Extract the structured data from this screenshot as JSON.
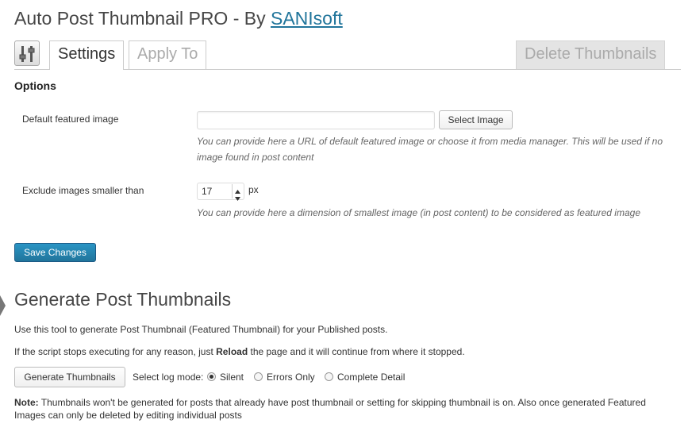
{
  "header": {
    "title_prefix": "Auto Post Thumbnail PRO - By ",
    "title_link": "SANIsoft"
  },
  "tabs": [
    {
      "label": "Settings",
      "active": true
    },
    {
      "label": "Apply To",
      "active": false
    },
    {
      "label": "Delete Thumbnails",
      "active": false
    }
  ],
  "options": {
    "heading": "Options",
    "default_image": {
      "label": "Default featured image",
      "value": "",
      "button": "Select Image",
      "description": "You can provide here a URL of default featured image or choose it from media manager. This will be used if no image found in post content"
    },
    "exclude": {
      "label": "Exclude images smaller than",
      "value": "17",
      "unit": "px",
      "description": "You can provide here a dimension of smallest image (in post content) to be considered as featured image"
    },
    "save_label": "Save Changes"
  },
  "generate": {
    "heading": "Generate Post Thumbnails",
    "intro": "Use this tool to generate Post Thumbnail (Featured Thumbnail) for your Published posts.",
    "reload_pre": "If the script stops executing for any reason, just ",
    "reload_bold": "Reload",
    "reload_post": " the page and it will continue from where it stopped.",
    "button": "Generate Thumbnails",
    "log_mode_label": "Select log mode:",
    "log_modes": [
      {
        "label": "Silent",
        "checked": true
      },
      {
        "label": "Errors Only",
        "checked": false
      },
      {
        "label": "Complete Detail",
        "checked": false
      }
    ],
    "note_bold": "Note:",
    "note_text": " Thumbnails won't be generated for posts that already have post thumbnail or setting for skipping thumbnail is on. Also once generated Featured Images can only be deleted by editing individual posts"
  },
  "colors": {
    "link": "#21759b",
    "primary_button": "#21759b"
  }
}
